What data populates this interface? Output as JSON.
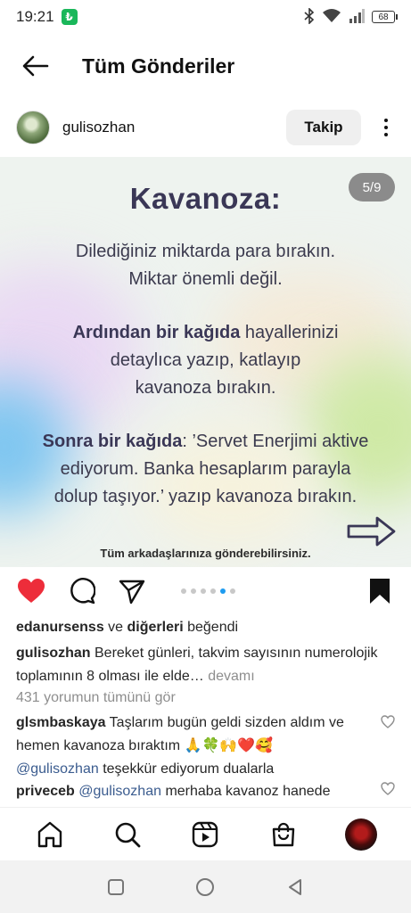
{
  "status_bar": {
    "time": "19:21",
    "app_badge": "₺",
    "battery": "68"
  },
  "header": {
    "title": "Tüm Gönderiler"
  },
  "post": {
    "username": "gulisozhan",
    "follow_label": "Takip",
    "slide": {
      "counter": "5/9",
      "title": "Kavanoza:",
      "line1": "Dilediğiniz miktarda para bırakın.",
      "line2": "Miktar önemli değil.",
      "p2_bold": "Ardından bir kağıda",
      "p2_rest": " hayallerinizi",
      "p2_line2": "detaylıca yazıp, katlayıp",
      "p2_line3": "kavanoza bırakın.",
      "p3_bold": "Sonra bir kağıda",
      "p3_rest": ": ’Servet Enerjimi aktive",
      "p3_line2": "ediyorum. Banka hesaplarım parayla",
      "p3_line3": "dolup taşıyor.’ yazıp kavanoza bırakın.",
      "footer": "Tüm arkadaşlarınıza gönderebilirsiniz."
    },
    "carousel": {
      "count": 6,
      "active_index": 4
    },
    "likes": {
      "user": "edanursenss",
      "middle": " ve ",
      "others": "diğerleri",
      "suffix": " beğendi"
    },
    "caption": {
      "user": "gulisozhan",
      "text": " Bereket günleri, takvim sayısının numerolojik toplamının 8 olması ile elde…",
      "more": " devamı"
    },
    "view_comments": "431 yorumun tümünü gör",
    "comments": [
      {
        "user": "glsmbaskaya",
        "text": " Taşlarım bugün geldi sizden aldım ve hemen kavanoza bıraktım 🙏🍀🙌❤️🥰",
        "mention": "@gulisozhan",
        "tail": "  teşekkür ediyorum dualarla"
      },
      {
        "user": "priveceb",
        "mention": " @gulisozhan",
        "text": "  merhaba kavanoz hanede"
      }
    ]
  },
  "colors": {
    "like_red": "#ed2d3a",
    "accent_blue": "#1d9bf0",
    "slide_text": "#3a3756"
  }
}
